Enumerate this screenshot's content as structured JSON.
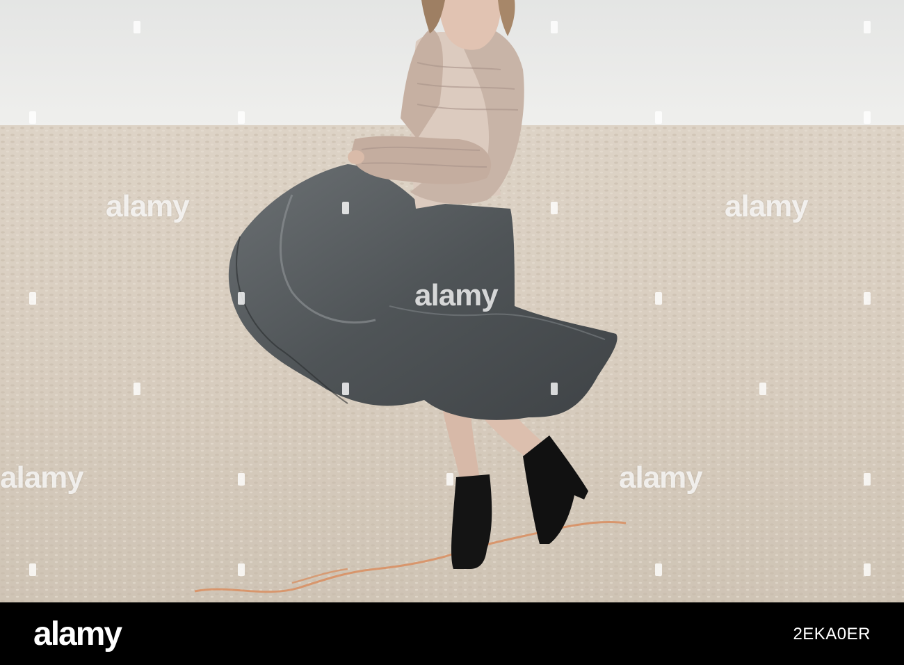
{
  "photo": {
    "watermark_text": "alamy",
    "colors": {
      "sky": "#e9e9e8",
      "ground": "#d9cfc1",
      "skirt": "#5a5f62",
      "jacket": "#c9b4a6",
      "boots": "#121212"
    }
  },
  "footer": {
    "brand": "alamy",
    "image_id": "2EKA0ER"
  }
}
